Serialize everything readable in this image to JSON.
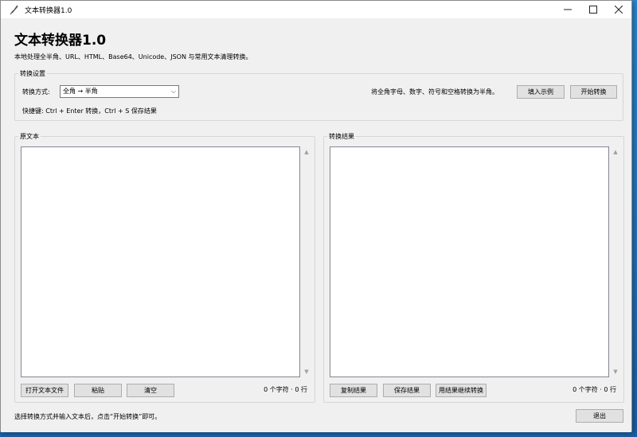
{
  "window": {
    "title": "文本转换器1.0"
  },
  "header": {
    "title": "文本转换器1.0",
    "subtitle": "本地处理全半角、URL、HTML、Base64、Unicode、JSON 与常用文本清理转换。"
  },
  "settings": {
    "group_label": "转换设置",
    "mode_label": "转换方式:",
    "mode_value": "全角 → 半角",
    "description": "将全角字母、数字、符号和空格转换为半角。",
    "fill_example_label": "填入示例",
    "start_label": "开始转换",
    "shortcut_hint": "快捷键: Ctrl + Enter 转换，Ctrl + S 保存结果"
  },
  "source": {
    "group_label": "原文本",
    "value": "",
    "open_file_label": "打开文本文件",
    "paste_label": "粘贴",
    "clear_label": "清空",
    "count": "0 个字符 · 0 行"
  },
  "result": {
    "group_label": "转换结果",
    "value": "",
    "copy_label": "复制结果",
    "save_label": "保存结果",
    "continue_label": "用结果继续转换",
    "count": "0 个字符 · 0 行"
  },
  "status": {
    "text": "选择转换方式并输入文本后，点击“开始转换”即可。",
    "exit_label": "退出"
  }
}
